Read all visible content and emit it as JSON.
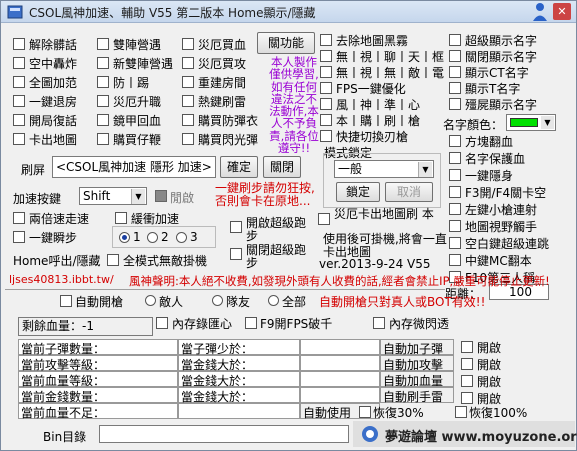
{
  "title": "CSOL風神加速、輔助 V55 第二版本 Home顯示/隱藏",
  "colors": {
    "red_text": "#d40000",
    "purple_text": "#9a00d4",
    "name_color_swatch": "#00e000"
  },
  "col1": [
    "解除髒話",
    "空中轟炸",
    "全圖加范",
    "一鍵退房",
    "開局復話",
    "卡出地圖"
  ],
  "col2": [
    "雙陣營遇",
    "新雙陣營遇",
    "防丨踢",
    "災厄升職",
    "鏡甲回血",
    "購買仔鞭"
  ],
  "col3": [
    "災厄買血",
    "災厄買攻",
    "重建房間",
    "熱鍵刷雷",
    "購買防彈衣",
    "購買閃光彈"
  ],
  "toggle_button": "關功能",
  "notice": [
    "本人製作",
    "僅供學習,",
    "如有任何",
    "違法之不",
    "法動作,本",
    "人不予負",
    "責,請各位",
    "遵守!!"
  ],
  "col4": [
    "去除地圖黑霧",
    "無丨視丨聊丨天丨框",
    "無丨視丨無丨敵丨電",
    "FPS一鍵優化",
    "風丨神丨準丨心",
    "本丨購丨刷丨槍",
    "快捷切換刃槍"
  ],
  "col5": [
    "超級顯示名字",
    "關閉顯示名字",
    "顯示CT名字",
    "顯示T名字",
    "殭屍顯示名字"
  ],
  "name_color_label": "名字顏色：",
  "col5b": [
    "方塊翻血",
    "名字保護血",
    "一鍵隱身",
    "F3開/F4關卡空",
    "左鍵小槍連射",
    "地圖視野觸手",
    "空白鍵超級連跳",
    "中鍵MC翻本",
    "F10第三人稱"
  ],
  "distance_label": "距離：",
  "distance_value": "100",
  "mode_lock_label": "模式鎖定",
  "mode_value": "一般",
  "lock_button": "鎖定",
  "cancel_button": "取消",
  "refresh_label": "刷屏",
  "refresh_text": "<CSOL風神加速 隱形 加速>",
  "confirm_button": "確定",
  "close_button": "關閉",
  "hotkey_note": [
    "一鍵刷步請勿狂按,",
    "否則會卡在原地..."
  ],
  "speed_key_label": "加速按鍵",
  "speed_key_value": "Shift",
  "disable_label": "閒啟",
  "two_step_label": "兩倍速走速",
  "slow_label": "緩衝加速",
  "one_key_label": "一鍵瞬步",
  "radios": [
    "1",
    "2",
    "3"
  ],
  "super_jump_label": "開啟超級跑步",
  "close_super_jump_label": "關閉超級跑步",
  "stuck_label": "災厄卡出地圖刷\\n本",
  "stuck_note": [
    "使用後可掛機,將會一直",
    "卡出地圖"
  ],
  "version": "ver.2013-9-24 V55",
  "home_label": "Home呼出/隱藏",
  "fullscreen_label": "全模式無敵掛機",
  "url": "ljses40813.ibbt.tw/",
  "declaration": "風神聲明:本人絕不收費,如發現外頭有人收費的話,經者會禁止IP,嚴重可能停止更新!",
  "auto_open_label": "自動開槍",
  "target_radios": [
    "敵人",
    "隊友",
    "全部"
  ],
  "auto_note": "自動開槍只對真人或BOT有效!!",
  "remain_hp_label": "剩餘血量：-1",
  "mem_label": "內存錄匯心",
  "fps_label": "F9開FPS破千",
  "mem_flash_label": "內存微閃透",
  "grid_left": [
    "當前子彈數量：",
    "當前攻擊等級：",
    "當前血量等級：",
    "當前金錢數量：",
    "當前血量不足："
  ],
  "grid_mid": [
    "當子彈少於：",
    "當金錢大於：",
    "當金錢大於：",
    "當金錢大於："
  ],
  "grid_right": [
    "自動加子彈",
    "自動加攻擊",
    "自動加血量",
    "自動刷手雷"
  ],
  "grid_enable": [
    "開啟",
    "開啟",
    "開啟",
    "開啟"
  ],
  "auto_use_label": "自動使用",
  "hp_restore_30": "恢復30%",
  "hp_restore_100": "恢復100%",
  "bin_label": "Bin目錄",
  "watermark": "夢遊論壇 www.moyuzone.org"
}
